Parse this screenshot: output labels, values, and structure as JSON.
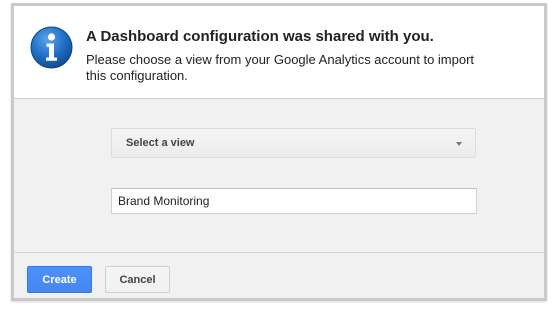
{
  "dialog": {
    "title": "A Dashboard configuration was shared with you.",
    "message": "Please choose a view from your Google Analytics account to import this configuration.",
    "icon": "info-icon"
  },
  "form": {
    "view_select": {
      "selected": "Select a view"
    },
    "name_input": {
      "value": "Brand Monitoring"
    }
  },
  "footer": {
    "create_label": "Create",
    "cancel_label": "Cancel"
  },
  "colors": {
    "icon_blue": "#1f6fc4",
    "primary_button": "#4d90fe",
    "panel_background": "#f1f1f1"
  }
}
